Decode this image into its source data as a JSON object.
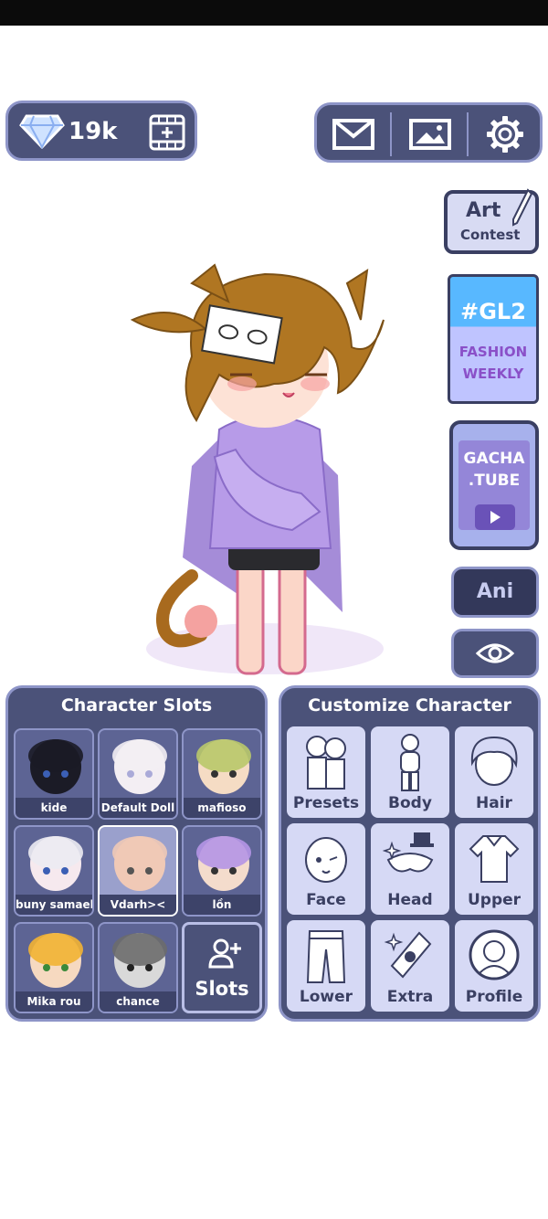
{
  "currency": {
    "icon": "diamond-icon",
    "amount": "19k",
    "video_icon": "film-plus-icon"
  },
  "top_buttons": [
    {
      "icon": "mail-icon"
    },
    {
      "icon": "gallery-icon"
    },
    {
      "icon": "gear-icon"
    }
  ],
  "side": {
    "art_contest": {
      "line1": "Art",
      "line2": "Contest"
    },
    "fashion": {
      "line1": "#GL2",
      "line2": "FASHION",
      "line3": "WEEKLY"
    },
    "tube": {
      "line1": "GACHA",
      "line2": ".TUBE"
    },
    "ani": "Ani",
    "eye_icon": "eye-icon"
  },
  "slots_panel": {
    "title": "Character Slots",
    "items": [
      {
        "label": "kide",
        "skin": "#1b1b26",
        "hair": "#1b1b26"
      },
      {
        "label": "Default Doll",
        "skin": "#f3eef3",
        "hair": "#f3eef3"
      },
      {
        "label": "mafioso",
        "skin": "#f5dcc4",
        "hair": "#b9c86a"
      },
      {
        "label": "buny samael",
        "skin": "#f6e9ee",
        "hair": "#ecebf2"
      },
      {
        "label": "Vdarh><",
        "skin": "#f0c9b6",
        "hair": "#f0c9b6"
      },
      {
        "label": "lồn",
        "skin": "#f4dccc",
        "hair": "#b595e6"
      },
      {
        "label": "Mika rou",
        "skin": "#f6d9c0",
        "hair": "#f2b233"
      },
      {
        "label": "chance",
        "skin": "#d9d9d9",
        "hair": "#6c6c6c"
      }
    ],
    "add_label": "Slots"
  },
  "customize_panel": {
    "title": "Customize Character",
    "items": [
      {
        "label": "Presets",
        "icon": "presets-icon"
      },
      {
        "label": "Body",
        "icon": "body-icon"
      },
      {
        "label": "Hair",
        "icon": "hair-icon"
      },
      {
        "label": "Face",
        "icon": "face-icon"
      },
      {
        "label": "Head",
        "icon": "head-icon"
      },
      {
        "label": "Upper",
        "icon": "upper-icon"
      },
      {
        "label": "Lower",
        "icon": "lower-icon"
      },
      {
        "label": "Extra",
        "icon": "extra-icon"
      },
      {
        "label": "Profile",
        "icon": "profile-icon"
      }
    ]
  }
}
